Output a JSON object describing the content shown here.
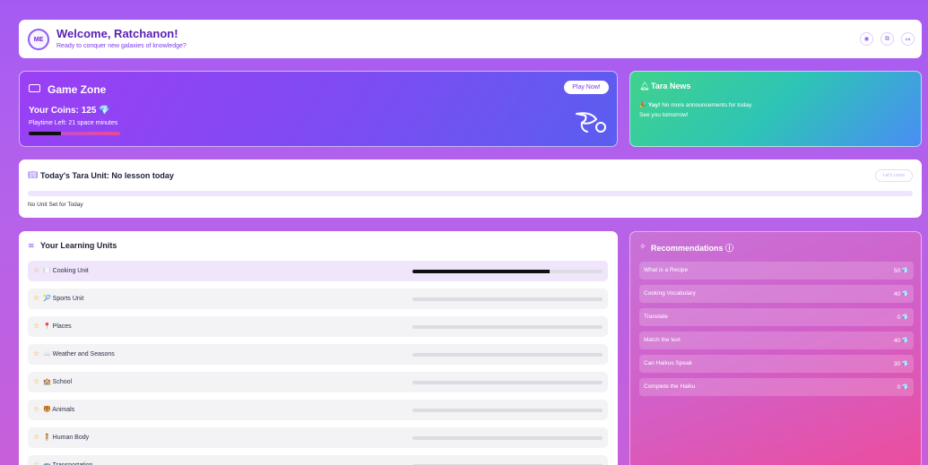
{
  "header": {
    "avatar": "ME",
    "welcome": "Welcome, Ratchanon!",
    "tagline": "Ready to conquer new galaxies of knowledge?",
    "icons": [
      "settings-icon",
      "book-icon",
      "logout-icon"
    ]
  },
  "game": {
    "title": "Game Zone",
    "coins": "Your Coins: 125",
    "playtime": "Playtime Left: 21 space minutes",
    "playtime_progress": 0.35,
    "play_button": "Play Now!"
  },
  "news": {
    "title": "Tara News",
    "line1_bold": "Yay!",
    "line1": "No more announcements for today.",
    "line2": "See you tomorrow!"
  },
  "today": {
    "title": "Today's Tara Unit: No lesson today",
    "button": "Let's Learn",
    "empty": "No Unit Set for Today"
  },
  "units": {
    "title": "Your Learning Units",
    "items": [
      {
        "emoji": "🍽️",
        "label": "Cooking Unit",
        "progress": 0.72
      },
      {
        "emoji": "🎾",
        "label": "Sports Unit",
        "progress": 0
      },
      {
        "emoji": "📍",
        "label": "Places",
        "progress": 0
      },
      {
        "emoji": "☁️",
        "label": "Weather and Seasons",
        "progress": 0
      },
      {
        "emoji": "🏫",
        "label": "School",
        "progress": 0
      },
      {
        "emoji": "🐯",
        "label": "Animals",
        "progress": 0
      },
      {
        "emoji": "🧍",
        "label": "Human Body",
        "progress": 0
      },
      {
        "emoji": "🚌",
        "label": "Transportation",
        "progress": 0
      }
    ]
  },
  "recommendations": {
    "title": "Recommendations",
    "items": [
      {
        "label": "What is a Recipe",
        "value": "50"
      },
      {
        "label": "Cooking Vocabulary",
        "value": "40"
      },
      {
        "label": "Translate",
        "value": "0"
      },
      {
        "label": "Match the text",
        "value": "40"
      },
      {
        "label": "Can Haikus Speak",
        "value": "30"
      },
      {
        "label": "Complete the Haiku",
        "value": "0"
      }
    ]
  },
  "colors": {
    "accent": "#7c3aed",
    "news_gradient": [
      "#3fd28d",
      "#4a8df5"
    ],
    "recs_gradient": [
      "#c772d8",
      "#ec4d9c"
    ]
  }
}
